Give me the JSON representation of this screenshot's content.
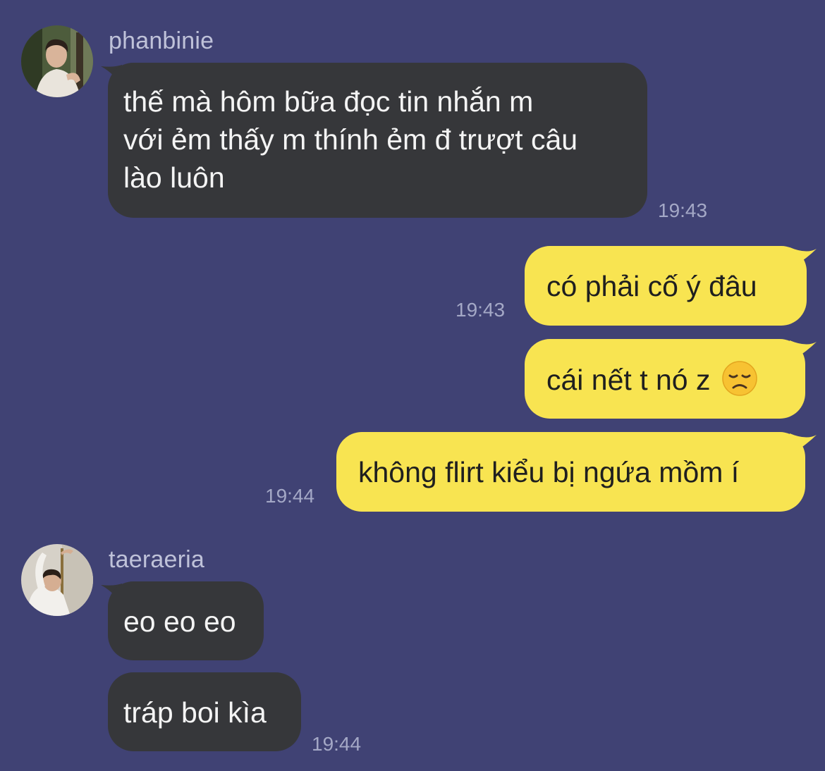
{
  "messages": [
    {
      "sender": "phanbinie",
      "avatar_icon": "profile-photo-icon",
      "direction": "incoming",
      "lines": [
        "thế mà hôm bữa đọc tin nhắn m",
        "với ẻm thấy m thính ẻm đ trượt câu",
        "lào luôn"
      ],
      "time": "19:43"
    },
    {
      "direction": "outgoing",
      "text": "có phải cố ý đâu",
      "time": "19:43"
    },
    {
      "direction": "outgoing",
      "text": "cái nết t nó z",
      "emoji": "disappointed-face-icon"
    },
    {
      "direction": "outgoing",
      "text": "không flirt kiểu bị ngứa mồm í",
      "time": "19:44"
    },
    {
      "sender": "taeraeria",
      "avatar_icon": "profile-photo-icon",
      "direction": "incoming",
      "text": "eo eo eo"
    },
    {
      "direction": "incoming",
      "text": "tráp boi kìa",
      "time": "19:44"
    }
  ],
  "colors": {
    "background": "#404274",
    "incoming_bubble": "#36373a",
    "outgoing_bubble": "#f8e451",
    "timestamp": "#a4a8c6",
    "sender_name": "#bfc2d9"
  }
}
